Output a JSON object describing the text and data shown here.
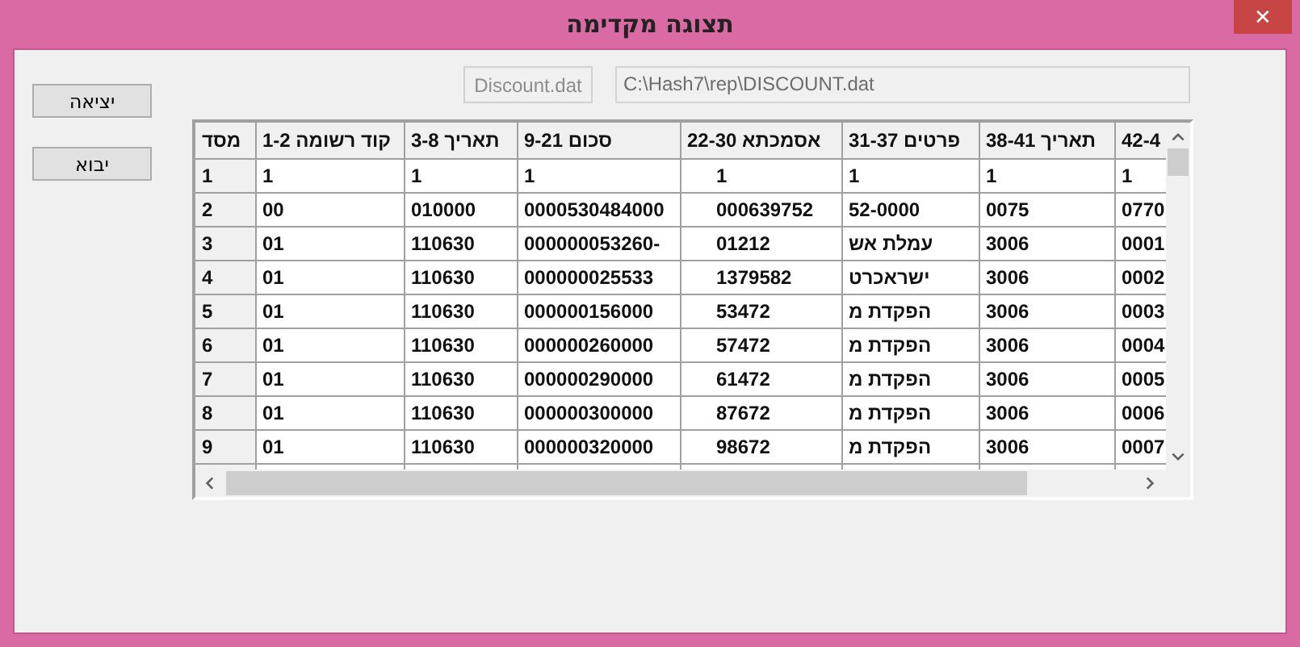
{
  "window": {
    "title": "תצוגה מקדימה",
    "close": "✕"
  },
  "buttons": [
    {
      "label": "יציאה"
    },
    {
      "label": "יבוא"
    }
  ],
  "file_button": {
    "label": "Discount.dat",
    "disabled": true
  },
  "path_field": {
    "value": "C:\\Hash7\\rep\\DISCOUNT.dat",
    "disabled": true
  },
  "table": {
    "columns": [
      "מסד",
      "קוד רשומה 1-2",
      "תאריך 3-8",
      "סכום 9-21",
      "אסמכתא 22-30",
      "פרטים 31-37",
      "תאריך 38-41",
      "42-4"
    ],
    "rows": [
      [
        "1",
        "1",
        "1",
        "1",
        "1",
        "1",
        "1",
        "1"
      ],
      [
        "2",
        "00",
        "010000",
        "0000530484000",
        "000639752",
        "52-0000",
        "0075",
        "0770"
      ],
      [
        "3",
        "01",
        "110630",
        "000000053260-",
        "01212",
        "עמלת אש",
        "3006",
        "0001"
      ],
      [
        "4",
        "01",
        "110630",
        "000000025533",
        "1379582",
        "ישראכרט",
        "3006",
        "0002"
      ],
      [
        "5",
        "01",
        "110630",
        "000000156000",
        "53472",
        "הפקדת מ",
        "3006",
        "0003"
      ],
      [
        "6",
        "01",
        "110630",
        "000000260000",
        "57472",
        "הפקדת מ",
        "3006",
        "0004"
      ],
      [
        "7",
        "01",
        "110630",
        "000000290000",
        "61472",
        "הפקדת מ",
        "3006",
        "0005"
      ],
      [
        "8",
        "01",
        "110630",
        "000000300000",
        "87672",
        "הפקדת מ",
        "3006",
        "0006"
      ],
      [
        "9",
        "01",
        "110630",
        "000000320000",
        "98672",
        "הפקדת מ",
        "3006",
        "0007"
      ]
    ]
  }
}
